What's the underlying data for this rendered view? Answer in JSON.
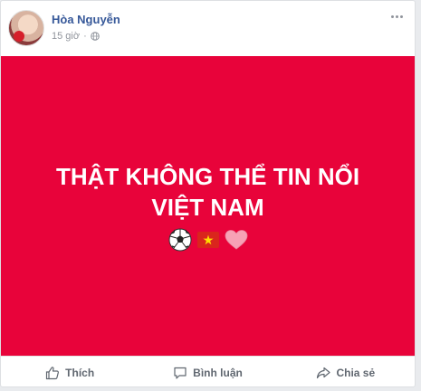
{
  "post": {
    "author_name": "Hòa Nguyễn",
    "timestamp": "15 giờ",
    "separator": "·",
    "banner": {
      "background": "#e8033a",
      "line1": "THẬT KHÔNG THỂ TIN NỔI",
      "line2": "VIỆT NAM",
      "emojis": [
        "soccer-ball-icon",
        "vietnam-flag-icon",
        "heart-icon"
      ]
    }
  },
  "actions": {
    "like_label": "Thích",
    "comment_label": "Bình luận",
    "share_label": "Chia sẻ"
  },
  "colors": {
    "name": "#365899",
    "meta": "#90949c",
    "action_text": "#606770"
  }
}
